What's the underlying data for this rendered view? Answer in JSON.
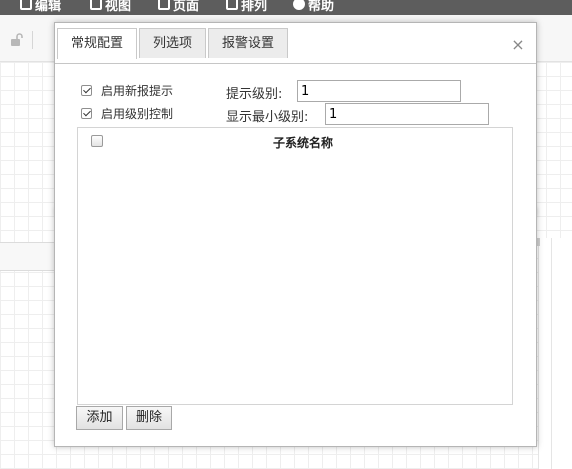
{
  "menubar": {
    "items": [
      {
        "label": "编辑",
        "icon": "edit-icon"
      },
      {
        "label": "视图",
        "icon": "view-icon"
      },
      {
        "label": "页面",
        "icon": "page-icon"
      },
      {
        "label": "排列",
        "icon": "arrange-icon"
      },
      {
        "label": "帮助",
        "icon": "help-icon"
      }
    ]
  },
  "dialog": {
    "tabs": [
      {
        "label": "常规配置",
        "active": true
      },
      {
        "label": "列选项",
        "active": false
      },
      {
        "label": "报警设置",
        "active": false
      }
    ],
    "close_symbol": "×",
    "options": {
      "enable_new_alarm_prompt": {
        "label": "启用新报提示",
        "checked": true
      },
      "enable_level_control": {
        "label": "启用级别控制",
        "checked": true
      }
    },
    "prompt_level": {
      "label": "提示级别:",
      "value": "1"
    },
    "min_display_level": {
      "label": "显示最小级别:",
      "value": "1"
    },
    "table": {
      "columns": [
        "子系统名称"
      ],
      "rows": []
    },
    "buttons": {
      "add": "添加",
      "delete": "删除"
    }
  },
  "colors": {
    "menubar_bg": "#5d5d5d",
    "tab_inactive_bg": "#ececec",
    "dialog_border": "#b5b5b5"
  }
}
